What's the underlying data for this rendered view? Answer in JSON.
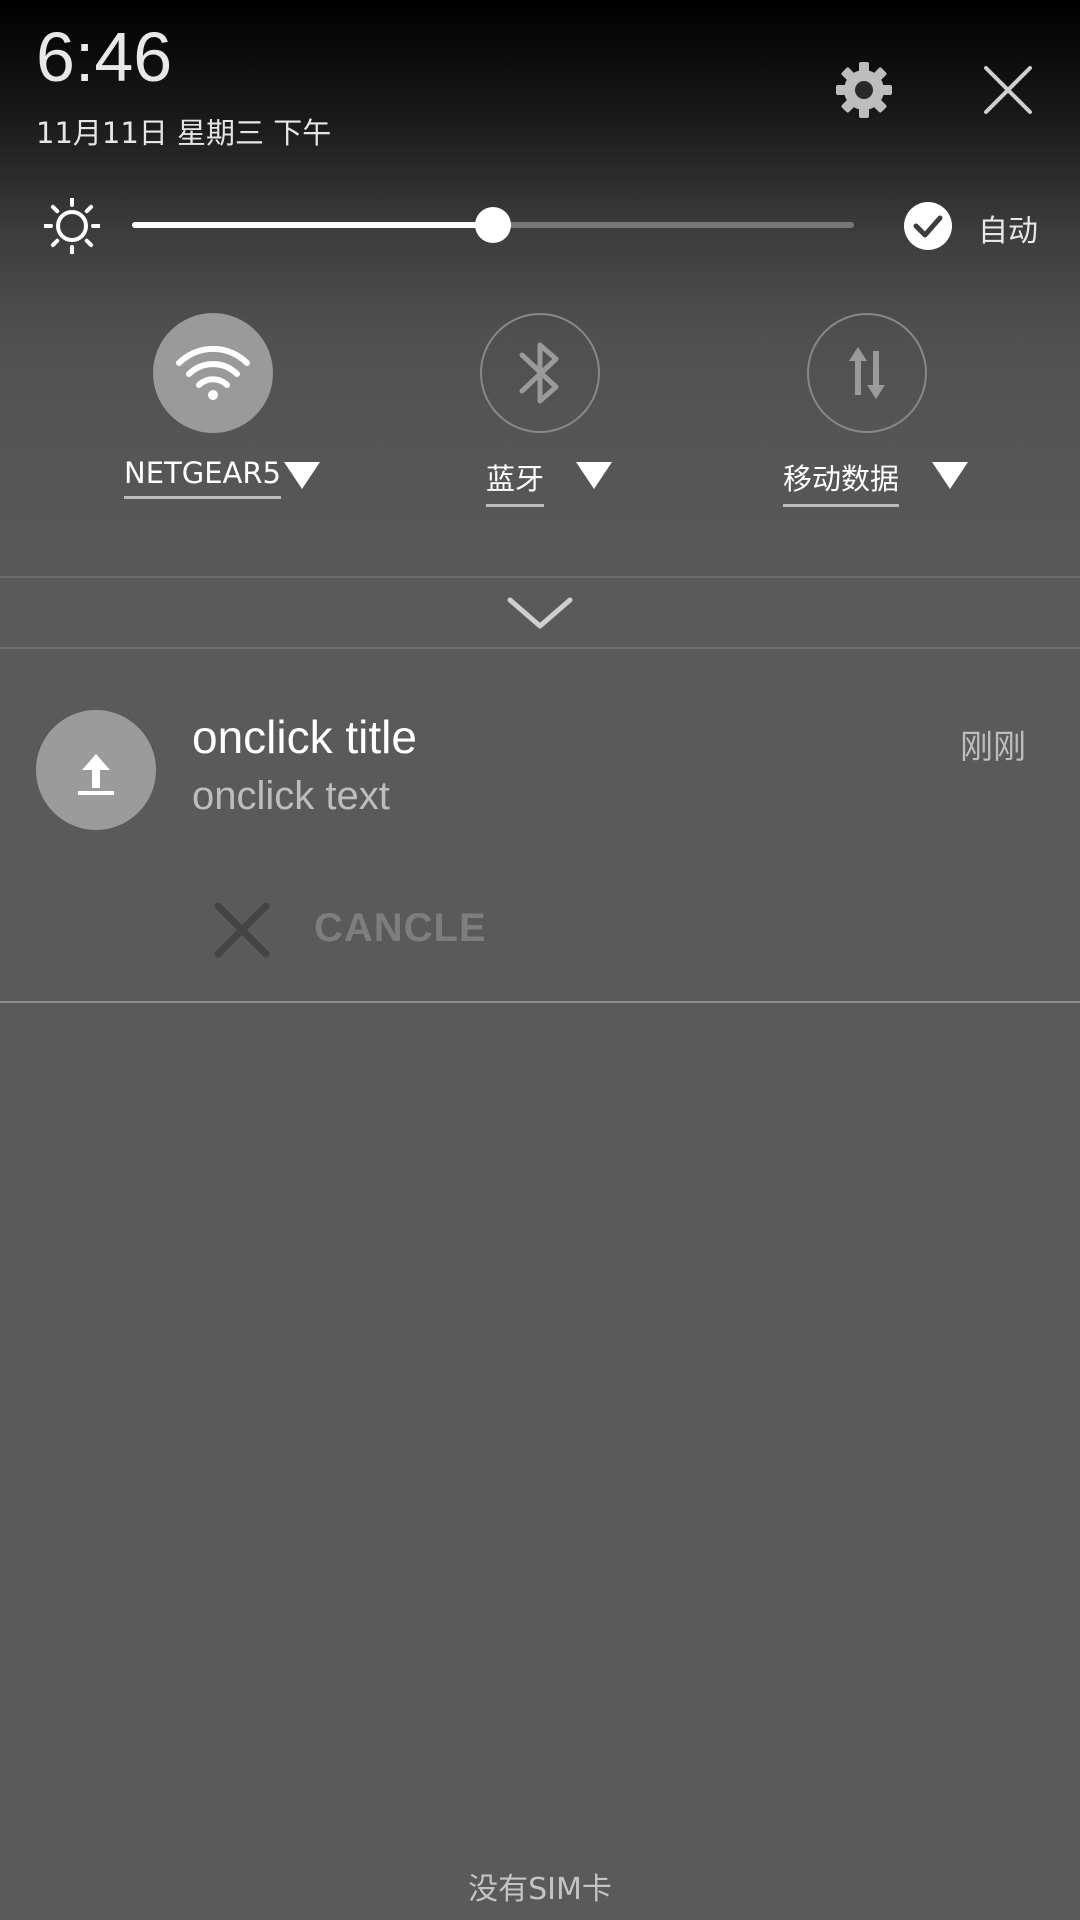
{
  "header": {
    "time": "6:46",
    "date": "11月11日 星期三 下午"
  },
  "brightness": {
    "level": 0.5,
    "auto_label": "自动",
    "auto_checked": true
  },
  "tiles": [
    {
      "id": "wifi",
      "label": "NETGEAR5",
      "active": true,
      "icon": "wifi-icon"
    },
    {
      "id": "bluetooth",
      "label": "蓝牙",
      "active": false,
      "icon": "bluetooth-icon"
    },
    {
      "id": "mobile-data",
      "label": "移动数据",
      "active": false,
      "icon": "mobile-data-icon"
    }
  ],
  "notification": {
    "title": "onclick title",
    "text": "onclick text",
    "time": "刚刚",
    "icon": "upload-icon",
    "action_label": "CANCLE"
  },
  "footer": {
    "carrier": "没有SIM卡"
  },
  "colors": {
    "panel": "#5a5a5a",
    "tile_active": "#9a9a9a",
    "action_text": "#7e7e7e"
  }
}
